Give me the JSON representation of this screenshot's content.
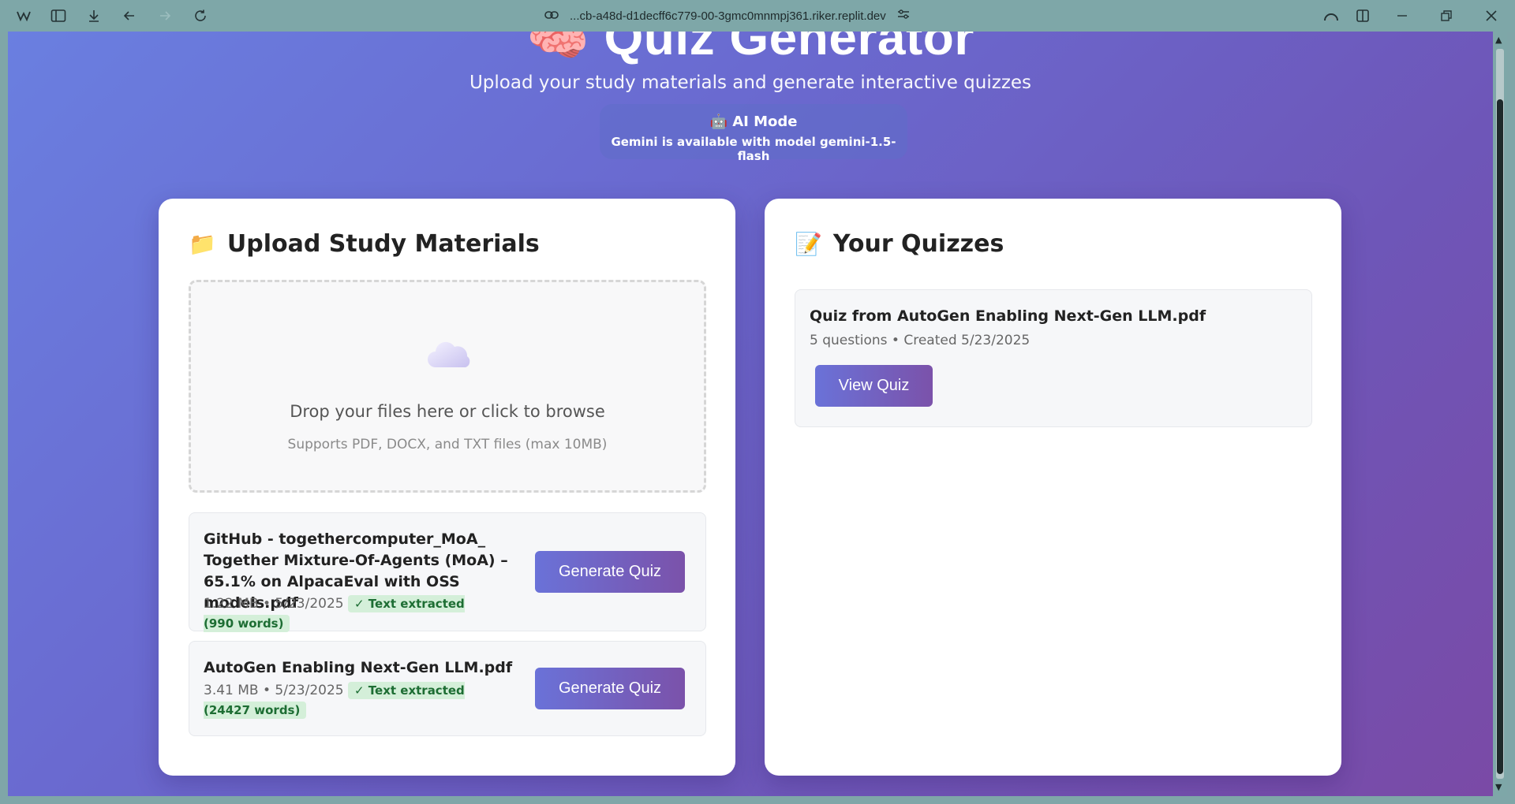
{
  "browser": {
    "url": "...cb-a48d-d1decff6c779-00-3gmc0mnmpj361.riker.replit.dev",
    "icons": [
      "app-logo-icon",
      "sidebar-toggle-icon",
      "download-icon",
      "back-icon",
      "forward-icon",
      "reload-icon",
      "link-icon",
      "site-settings-icon",
      "profile-icon",
      "split-view-icon",
      "minimize-icon",
      "restore-icon",
      "close-icon"
    ]
  },
  "hero": {
    "emoji": "🧠",
    "title": "Quiz Generator",
    "subtitle": "Upload your study materials and generate interactive quizzes"
  },
  "ai_mode": {
    "title": "🤖 AI Mode",
    "status": "Gemini is available with model gemini-1.5-flash"
  },
  "upload": {
    "emoji": "📁",
    "heading": "Upload Study Materials",
    "drop_text": "Drop your files here or click to browse",
    "supports": "Supports PDF, DOCX, and TXT files (max 10MB)",
    "files": [
      {
        "name": "GitHub - togethercomputer_MoA_ Together Mixture-Of-Agents (MoA) – 65.1% on AlpacaEval with OSS models.pdf",
        "meta": "1.22 MB • 5/23/2025",
        "status": "✓ Text extracted (990 words)",
        "button": "Generate Quiz"
      },
      {
        "name": "AutoGen Enabling Next-Gen LLM.pdf",
        "meta": "3.41 MB • 5/23/2025",
        "status": "✓ Text extracted (24427 words)",
        "button": "Generate Quiz"
      }
    ]
  },
  "quizzes": {
    "emoji": "📝",
    "heading": "Your Quizzes",
    "items": [
      {
        "title": "Quiz from AutoGen Enabling Next-Gen LLM.pdf",
        "meta": "5 questions • Created 5/23/2025",
        "button": "View Quiz"
      }
    ]
  }
}
